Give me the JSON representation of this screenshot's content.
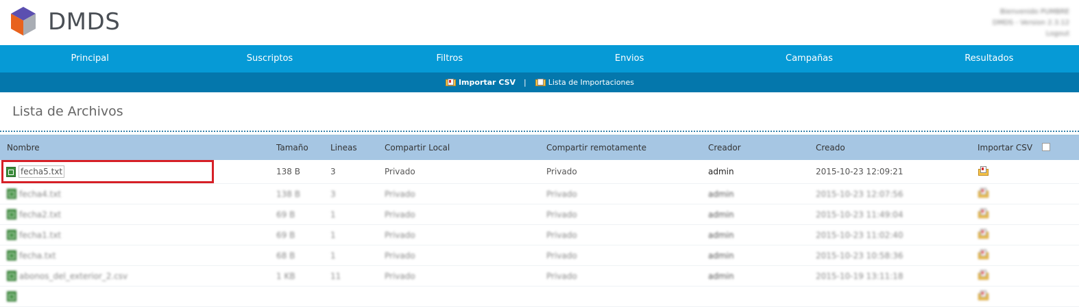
{
  "brand": {
    "name": "DMDS"
  },
  "user": {
    "lines": [
      "Bienvenido PUMBRE",
      "DMDS - Version 2.3.12",
      "Logout"
    ]
  },
  "nav": [
    "Principal",
    "Suscriptos",
    "Filtros",
    "Envios",
    "Campañas",
    "Resultados"
  ],
  "subnav": {
    "import_csv": "Importar CSV",
    "separator": "|",
    "import_list": "Lista de Importaciones"
  },
  "page": {
    "title": "Lista de Archivos"
  },
  "table": {
    "headers": [
      "Nombre",
      "Tamaño",
      "Lineas",
      "Compartir Local",
      "Compartir remotamente",
      "Creador",
      "Creado",
      "Importar CSV"
    ],
    "rows": [
      [
        "fecha5.txt",
        "138 B",
        "3",
        "Privado",
        "Privado",
        "admin",
        "2015-10-23 12:09:21"
      ],
      [
        "fecha4.txt",
        "138 B",
        "3",
        "Privado",
        "Privado",
        "admin",
        "2015-10-23 12:07:56"
      ],
      [
        "fecha2.txt",
        "69 B",
        "1",
        "Privado",
        "Privado",
        "admin",
        "2015-10-23 11:49:04"
      ],
      [
        "fecha1.txt",
        "69 B",
        "1",
        "Privado",
        "Privado",
        "admin",
        "2015-10-23 11:02:40"
      ],
      [
        "fecha.txt",
        "68 B",
        "1",
        "Privado",
        "Privado",
        "admin",
        "2015-10-23 10:58:36"
      ],
      [
        "abonos_del_exterior_2.csv",
        "1 KB",
        "11",
        "Privado",
        "Privado",
        "admin",
        "2015-10-19 13:11:18"
      ],
      [
        "",
        "",
        "",
        "",
        "",
        "",
        ""
      ]
    ]
  },
  "colors": {
    "nav": "#069ad6",
    "subnav": "#0477ac",
    "header_row": "#a6c6e3",
    "highlight": "#d61f26"
  }
}
